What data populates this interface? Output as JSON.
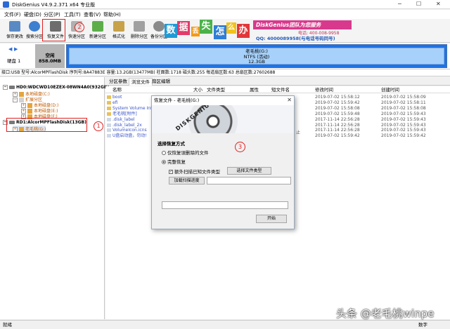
{
  "window": {
    "title": "DiskGenius V4.9.2.371 x64 专业版"
  },
  "menu": [
    "文件(F)",
    "硬盘(D)",
    "分区(P)",
    "工具(T)",
    "查看(V)",
    "帮助(H)"
  ],
  "toolbar": [
    {
      "label": "保存更改",
      "icon": "save-icon",
      "color": "#5a8ac4"
    },
    {
      "label": "搜索分区",
      "icon": "search-icon",
      "color": "#3f7fcf"
    },
    {
      "label": "恢复文件",
      "icon": "recover-icon",
      "color": "#6d6d6d"
    },
    {
      "label": "快速分区",
      "icon": "quick-partition-icon",
      "color": "#b0b0b0"
    },
    {
      "label": "新建分区",
      "icon": "new-partition-icon",
      "color": "#5dae4a"
    },
    {
      "label": "格式化",
      "icon": "format-icon",
      "color": "#c7a24a"
    },
    {
      "label": "删除分区",
      "icon": "delete-partition-icon",
      "color": "#a0a0a0"
    },
    {
      "label": "备份分区",
      "icon": "backup-icon",
      "color": "#8a8a8a"
    }
  ],
  "banner": {
    "chars": [
      {
        "t": "数",
        "c": "#1f9bd7"
      },
      {
        "t": "据",
        "c": "#e23a6a"
      },
      {
        "t": "丢",
        "c": "#f29a1a"
      },
      {
        "t": "失",
        "c": "#4bb24a"
      },
      {
        "t": "怎",
        "c": "#2f7ed8"
      },
      {
        "t": "么",
        "c": "#f2c21a"
      },
      {
        "t": "办",
        "c": "#e2373a"
      }
    ],
    "brand": "DiskGenius团队为您服务",
    "phone": "电话: 400-008-9958",
    "qq": "QQ: 4000089958(与电话号码同号)"
  },
  "disk_map": {
    "disk_label": "硬盘 1",
    "free": {
      "name": "空闲",
      "size": "858.0MB"
    },
    "partition": {
      "name": "老毛桃(G:)",
      "fs": "NTFS (活动)",
      "size": "12.3GB"
    }
  },
  "infobar": "接口:USB  型号:AlcorMPFlashDisk  序列号:8A47883E  容量:13.2GB(13477MB)  柱面数:1718  磁头数:255  每道扇区数:63  总扇区数:27602688",
  "tree": {
    "disk0": "HD0:WDCWD10EZEX-08WN4A0(932GB)",
    "disk0_parts": [
      "本地磁盘(C:)",
      "扩展分区",
      "本地磁盘(D:)",
      "本地磁盘(E:)",
      "本地磁盘(F:)"
    ],
    "disk1": "RD1:AlcorMPFlashDisk(13GB)",
    "disk1_parts": [
      "老毛桃(G:)"
    ]
  },
  "tabs": [
    "分区参数",
    "浏览文件",
    "扇区编辑"
  ],
  "file_columns": [
    "名称",
    "大小",
    "文件类型",
    "属性",
    "短文件名",
    "修改时间",
    "创建时间"
  ],
  "files": [
    {
      "name": "boot",
      "mod": "2019-07-02 15:58:12",
      "created": "2019-07-02 15:58:09"
    },
    {
      "name": "efi",
      "mod": "2019-07-02 15:59:42",
      "created": "2019-07-02 15:58:11"
    },
    {
      "name": "System Volume Inf",
      "mod": "2019-07-02 15:58:08",
      "created": "2019-07-02 15:58:08"
    },
    {
      "name": "老毛桃[附件]",
      "mod": "2019-07-02 15:59:48",
      "created": "2019-07-02 15:59:43"
    },
    {
      "name": ".disk_label",
      "mod": "2017-11-14 22:56:28",
      "created": "2019-07-02 15:59:43"
    },
    {
      "name": ".disk_label_2x",
      "mod": "2017-11-14 22:56:28",
      "created": "2019-07-02 15:59:43"
    },
    {
      "name": "VolumeIcon.icns",
      "mod": "2017-11-14 22:56:28",
      "created": "2019-07-02 15:59:43"
    },
    {
      "name": "U盘启动盘，勿动!",
      "mod": "2019-07-02 15:59:42",
      "created": "2019-07-02 15:59:42"
    }
  ],
  "dialog": {
    "title": "恢复文件 - 老毛桃(G:)",
    "banner_text": "DISKGENIUS",
    "section": "选择恢复方式",
    "opt1": "仅恢复误删除的文件",
    "opt2": "完整恢复",
    "check": "额外扫描已知文件类型",
    "select_types": "选择文件类型",
    "load_progress": "加载扫描进度",
    "start": "开始",
    "tail": "止"
  },
  "annotations": [
    "1",
    "2",
    "3"
  ],
  "status": {
    "left": "就绪",
    "right": "数字"
  },
  "watermark": "头条 @老毛桃winpe"
}
